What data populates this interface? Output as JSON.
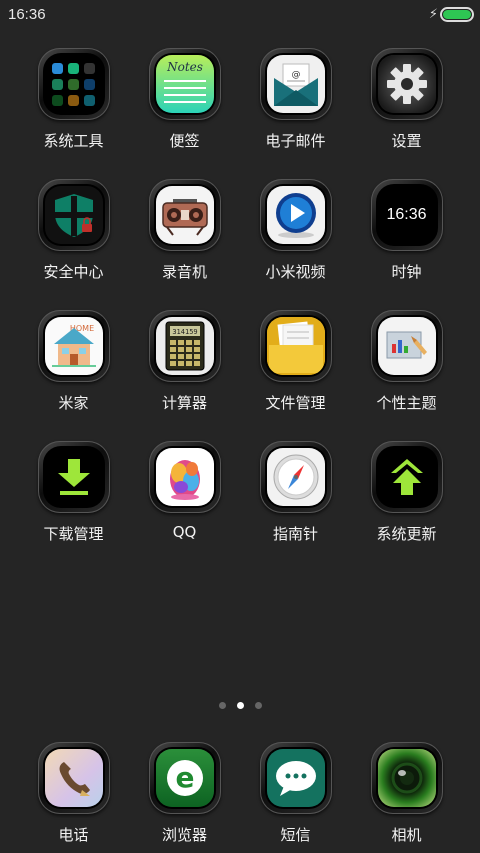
{
  "status_bar": {
    "time": "16:36",
    "battery_level": 1.0,
    "charging": true,
    "battery_color": "#2ec653"
  },
  "apps": [
    {
      "label": "系统工具",
      "icon": "tools-folder-icon"
    },
    {
      "label": "便签",
      "icon": "notes-icon",
      "icon_text": "Notes"
    },
    {
      "label": "电子邮件",
      "icon": "email-icon",
      "icon_text": "@"
    },
    {
      "label": "设置",
      "icon": "gear-icon"
    },
    {
      "label": "安全中心",
      "icon": "shield-icon"
    },
    {
      "label": "录音机",
      "icon": "recorder-icon"
    },
    {
      "label": "小米视频",
      "icon": "play-icon"
    },
    {
      "label": "时钟",
      "icon": "clock-icon",
      "icon_text": "16:36"
    },
    {
      "label": "米家",
      "icon": "house-icon",
      "icon_text": "HOME"
    },
    {
      "label": "计算器",
      "icon": "calculator-icon",
      "icon_text": "314159"
    },
    {
      "label": "文件管理",
      "icon": "folder-icon"
    },
    {
      "label": "个性主题",
      "icon": "theme-icon"
    },
    {
      "label": "下载管理",
      "icon": "download-icon"
    },
    {
      "label": "QQ",
      "icon": "qq-penguin-icon"
    },
    {
      "label": "指南针",
      "icon": "compass-icon"
    },
    {
      "label": "系统更新",
      "icon": "update-icon"
    }
  ],
  "page_indicator": {
    "count": 3,
    "active": 1
  },
  "dock": [
    {
      "label": "电话",
      "icon": "phone-icon"
    },
    {
      "label": "浏览器",
      "icon": "browser-icon",
      "icon_text": "e"
    },
    {
      "label": "短信",
      "icon": "message-icon"
    },
    {
      "label": "相机",
      "icon": "camera-icon"
    }
  ]
}
